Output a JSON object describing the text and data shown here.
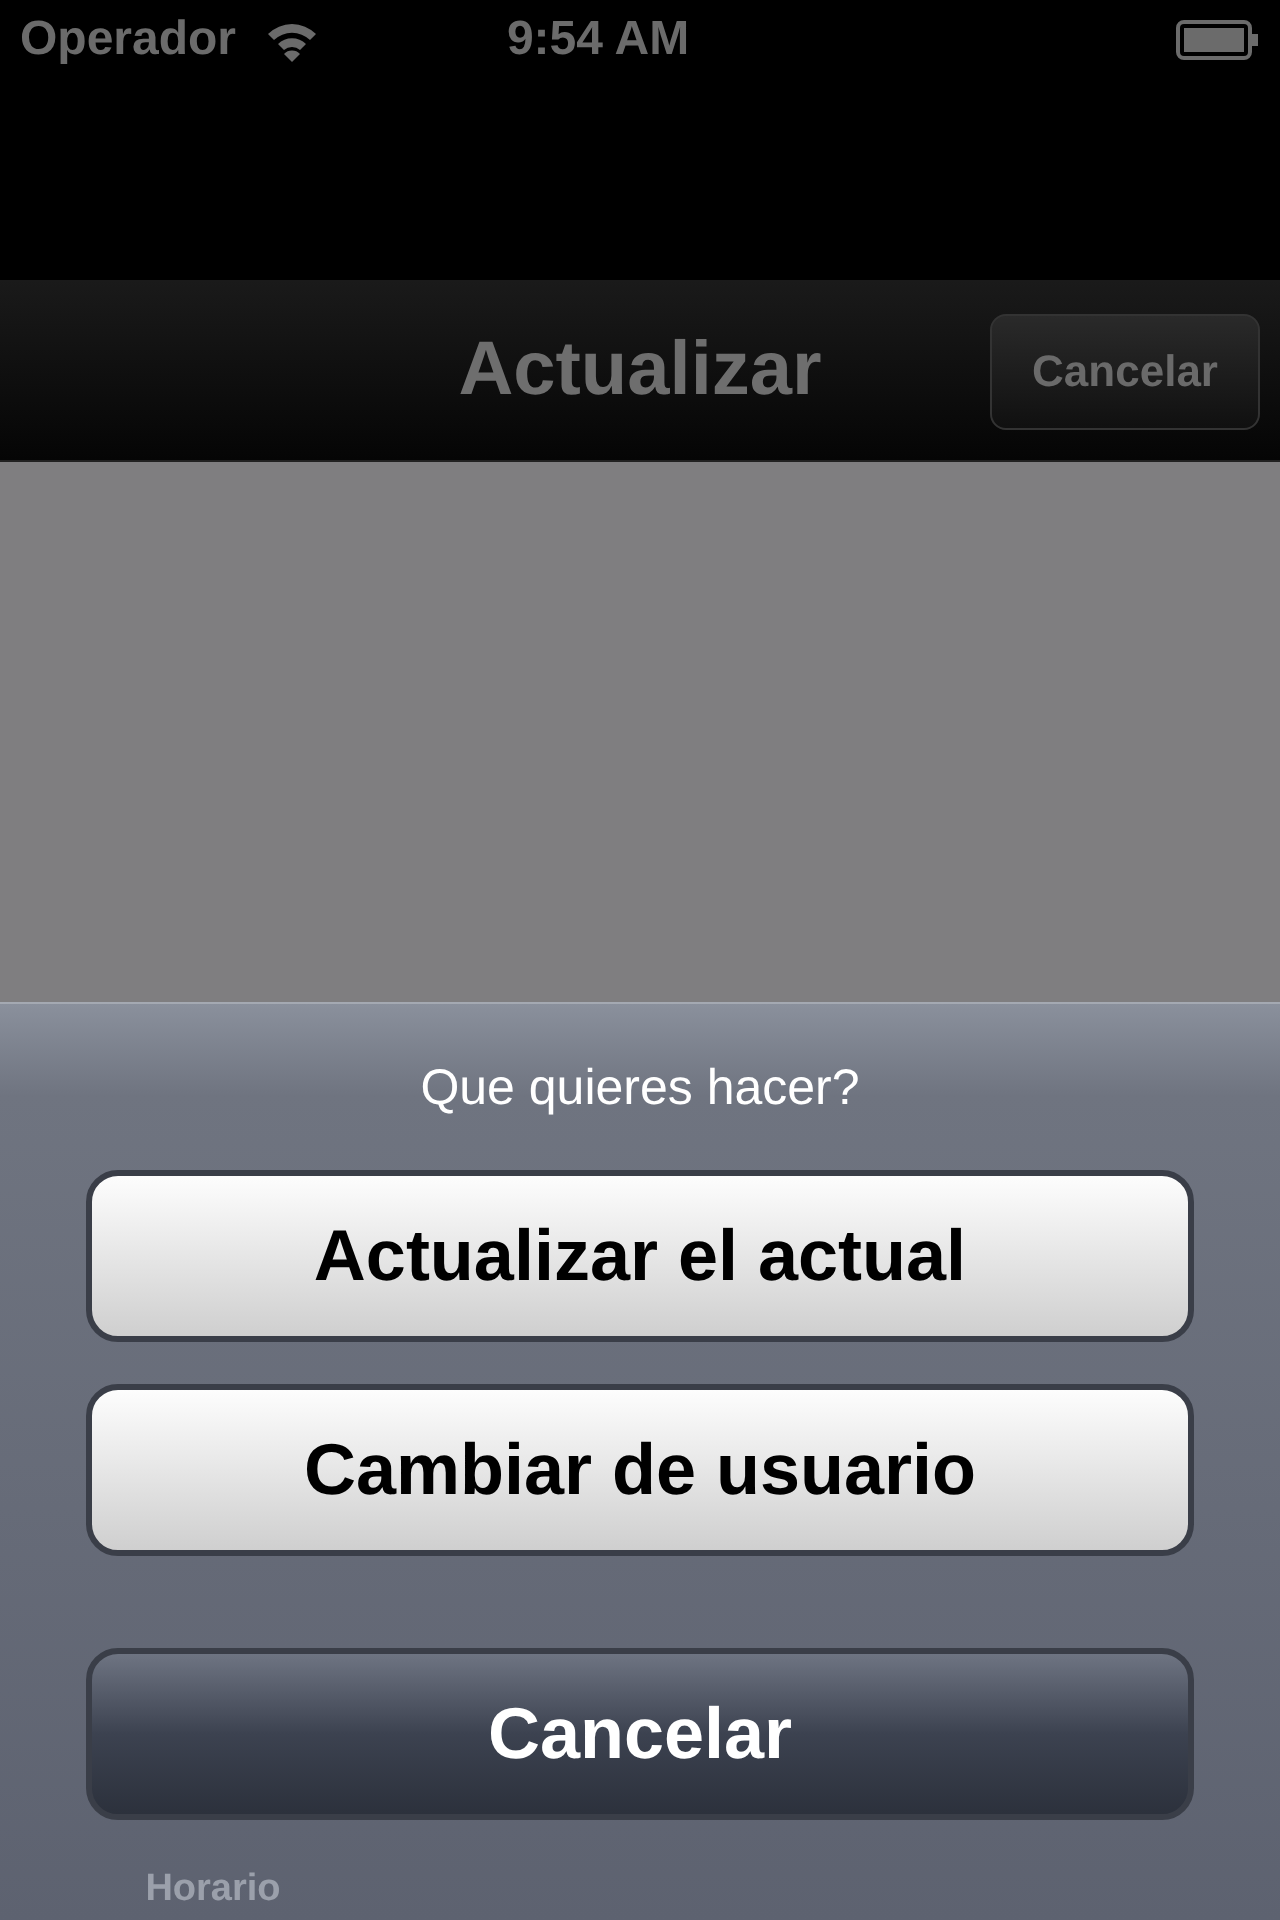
{
  "status_bar": {
    "carrier": "Operador",
    "time": "9:54 AM"
  },
  "nav_bar": {
    "title": "Actualizar",
    "button": "Cancelar"
  },
  "tab_bar": {
    "items": [
      "Horario"
    ]
  },
  "action_sheet": {
    "title": "Que quieres hacer?",
    "buttons": [
      {
        "label": "Actualizar el actual",
        "kind": "default"
      },
      {
        "label": "Cambiar de usuario",
        "kind": "default"
      },
      {
        "label": "Cancelar",
        "kind": "cancel"
      }
    ]
  }
}
